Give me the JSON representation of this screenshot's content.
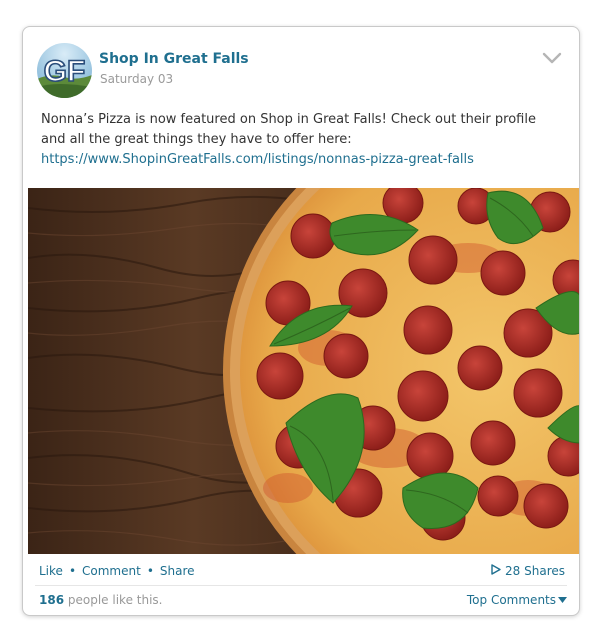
{
  "post": {
    "page_name": "Shop In Great Falls",
    "avatar_initials": "GF",
    "date": "Saturday 03",
    "text": "Nonna’s Pizza is now featured on Shop in Great Falls! Check out their profile and all the great things they have to offer here:",
    "link": "https://www.ShopinGreatFalls.com/listings/nonnas-pizza-great-falls"
  },
  "actions": {
    "like": "Like",
    "comment": "Comment",
    "share": "Share",
    "separator": "•",
    "shares_count": "28 Shares"
  },
  "footer": {
    "likes_count": "186",
    "likes_text": "people like this.",
    "top_comments": "Top Comments"
  },
  "colors": {
    "link": "#1f6f8f",
    "muted": "#999999"
  }
}
